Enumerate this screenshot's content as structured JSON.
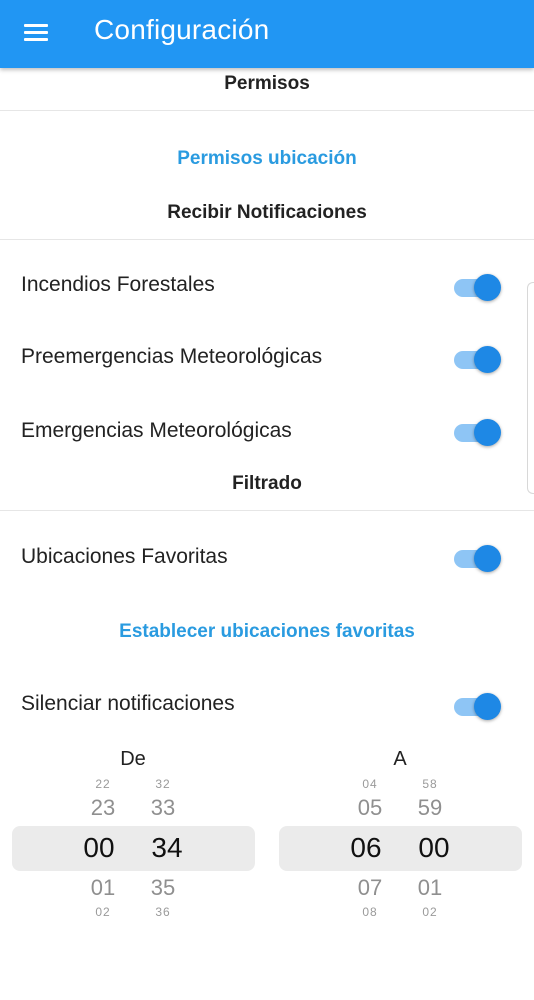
{
  "appbar": {
    "title": "Configuración",
    "menu_icon": "hamburger-menu-icon"
  },
  "sections": {
    "permisos": "Permisos",
    "recibir": "Recibir Notificaciones",
    "filtrado": "Filtrado"
  },
  "links": {
    "permisos_ubicacion": "Permisos ubicación",
    "favoritas": "Establecer ubicaciones favoritas"
  },
  "toggles": {
    "incendios": {
      "label": "Incendios Forestales",
      "on": true
    },
    "preemergencias": {
      "label": "Preemergencias Meteorológicas",
      "on": true
    },
    "emergencias": {
      "label": "Emergencias Meteorológicas",
      "on": true
    },
    "favoritas": {
      "label": "Ubicaciones Favoritas",
      "on": true
    },
    "silenciar": {
      "label": "Silenciar notificaciones",
      "on": true
    }
  },
  "picker": {
    "de": {
      "label": "De",
      "hours": [
        "22",
        "23",
        "00",
        "01",
        "02"
      ],
      "minutes": [
        "32",
        "33",
        "34",
        "35",
        "36"
      ]
    },
    "a": {
      "label": "A",
      "hours": [
        "04",
        "05",
        "06",
        "07",
        "08"
      ],
      "minutes": [
        "58",
        "59",
        "00",
        "01",
        "02"
      ]
    }
  },
  "colors": {
    "appbar": "#2196f3",
    "link": "#2a9be0",
    "switch_thumb": "#1e88e5",
    "switch_track": "#8ec5f5"
  }
}
